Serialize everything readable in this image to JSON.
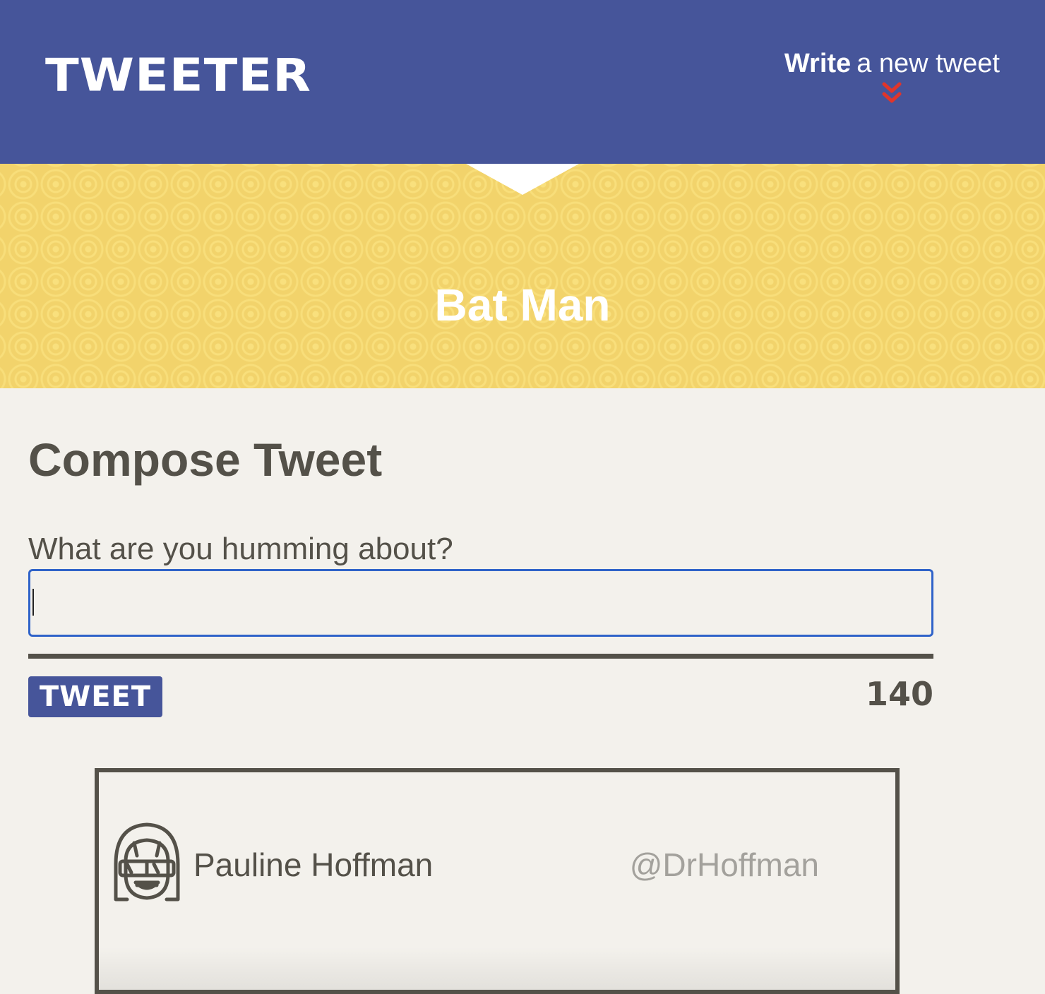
{
  "nav": {
    "brand": "TWEETER",
    "compose_toggle": {
      "strong": "Write",
      "light": "a new tweet",
      "icon": "double-chevron-down-icon"
    }
  },
  "banner": {
    "profile_name": "Bat Man"
  },
  "compose": {
    "title": "Compose Tweet",
    "label": "What are you humming about?",
    "input_value": "",
    "button_label": "TWEET",
    "counter": "140"
  },
  "tweet": {
    "author_name": "Pauline Hoffman",
    "author_handle": "@DrHoffman",
    "avatar_icon": "avatar-goggles-icon"
  },
  "colors": {
    "nav_bg": "#46559a",
    "banner_bg": "#f2d36b",
    "page_bg": "#f3f1ec",
    "text": "#545149",
    "chevron": "#e0352b",
    "input_focus": "#2f63c9",
    "handle": "#a3a19c"
  }
}
